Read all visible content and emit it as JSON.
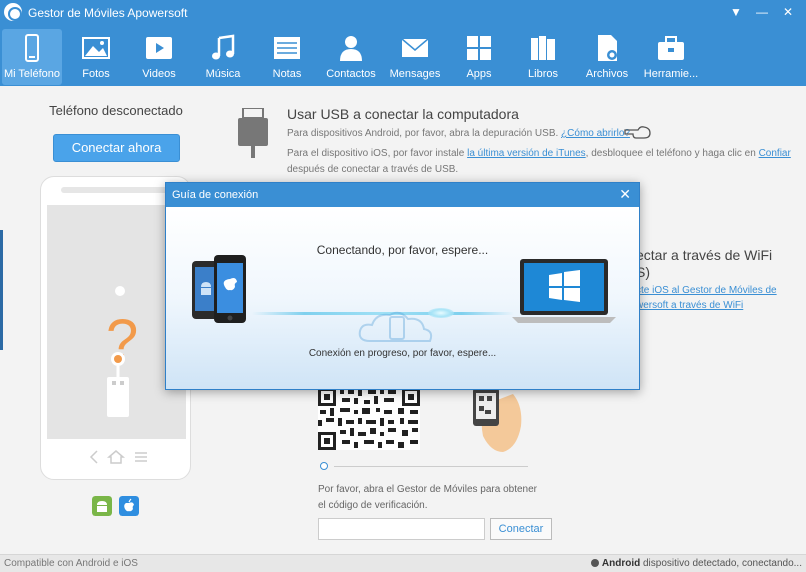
{
  "window": {
    "title": "Gestor de Móviles Apowersoft",
    "controls": [
      "▼",
      "—",
      "✕"
    ]
  },
  "toolbar": {
    "items": [
      {
        "label": "Mi Teléfono",
        "icon": "phone-icon",
        "active": true
      },
      {
        "label": "Fotos",
        "icon": "photo-icon"
      },
      {
        "label": "Videos",
        "icon": "video-icon"
      },
      {
        "label": "Música",
        "icon": "music-icon"
      },
      {
        "label": "Notas",
        "icon": "notes-icon"
      },
      {
        "label": "Contactos",
        "icon": "contacts-icon"
      },
      {
        "label": "Mensages",
        "icon": "messages-icon"
      },
      {
        "label": "Apps",
        "icon": "apps-icon"
      },
      {
        "label": "Libros",
        "icon": "books-icon"
      },
      {
        "label": "Archivos",
        "icon": "files-icon"
      },
      {
        "label": "Herramie...",
        "icon": "tools-icon"
      }
    ]
  },
  "left_panel": {
    "status": "Teléfono desconectado",
    "connect_button": "Conectar ahora",
    "question_mark": "?"
  },
  "usb": {
    "title": "Usar USB a conectar la computadora",
    "android_text": "Para dispositivos Android, por favor, abra la depuración USB.",
    "android_link": "¿Cómo abrirlo?",
    "ios_text_a": "Para el dispositivo iOS, por favor instale ",
    "ios_link_itunes": "la última versión de iTunes",
    "ios_text_b": ", desbloquee el teléfono y haga clic en ",
    "ios_link_trust": "Confiar",
    "ios_text_c": "después de conectar a través de USB."
  },
  "wifi": {
    "title": "ectar a través de WiFi",
    "subtitle": "S)",
    "link1": "cte iOS al Gestor de Móviles de",
    "link2": "wersoft a través de WiFi"
  },
  "verify": {
    "text1": "Por favor, abra el Gestor de Móviles para obtener",
    "text2": "el código de verificación.",
    "input_value": "",
    "connect_button": "Conectar"
  },
  "statusbar": {
    "left": "Compatible con Android e iOS",
    "right_bold": "Android",
    "right_rest": " dispositivo detectado, conectando..."
  },
  "dialog": {
    "title": "Guía de conexión",
    "close": "✕",
    "connecting": "Conectando, por favor, espere...",
    "progress": "Conexión en progreso, por favor, espere..."
  },
  "colors": {
    "brand": "#3a8fd4",
    "toolbar_active": "#5aa6e3",
    "question_orange": "#f29a4a",
    "android_green": "#7ab648",
    "ios_blue": "#2f8ee0",
    "windows_blue": "#1e88d6"
  }
}
